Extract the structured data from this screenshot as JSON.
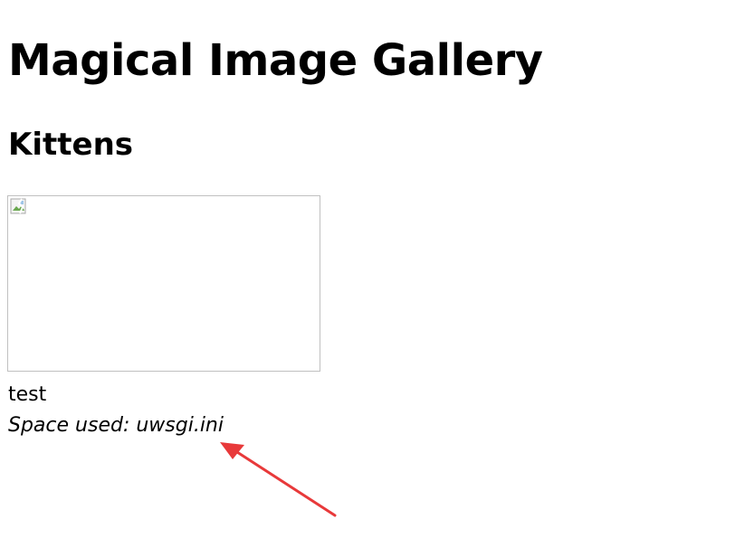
{
  "page": {
    "title": "Magical Image Gallery"
  },
  "gallery": {
    "section_title": "Kittens",
    "items": [
      {
        "image_state": "broken-image",
        "caption": "test",
        "space_used_text": "Space used: uwsgi.ini"
      }
    ]
  },
  "annotation": {
    "arrow_color": "#e8393a",
    "icon": "red-arrow-icon"
  }
}
